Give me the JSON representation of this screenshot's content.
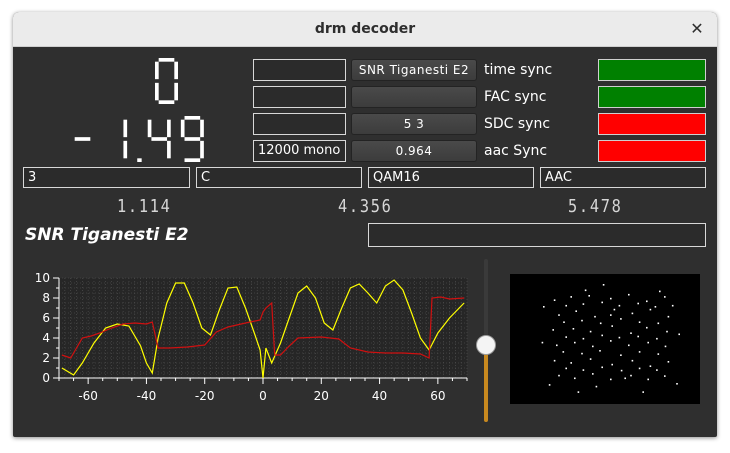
{
  "window": {
    "title": "drm decoder",
    "close_glyph": "✕"
  },
  "display": {
    "big_value_1": "0",
    "big_value_2": "-1.49"
  },
  "fields": {
    "col1": [
      "",
      "",
      "",
      "12000 mono"
    ],
    "col2": [
      "SNR Tiganesti E2",
      "",
      "5 3",
      "0.964"
    ]
  },
  "sync": [
    {
      "label": "time sync",
      "color": "#008000"
    },
    {
      "label": "FAC sync",
      "color": "#008000"
    },
    {
      "label": "SDC sync",
      "color": "#ff0000"
    },
    {
      "label": "aac Sync",
      "color": "#ff0000"
    }
  ],
  "mode_fields": [
    "3",
    "C",
    "QAM16",
    "AAC"
  ],
  "small_readouts": [
    "1.114",
    "4.356",
    "5.478"
  ],
  "station_name": "SNR Tiganesti E2",
  "station_text": "",
  "slider": {
    "value_fraction": 0.47
  },
  "chart_data": {
    "type": "line",
    "title": "",
    "xlabel": "",
    "ylabel": "",
    "xlim": [
      -70,
      70
    ],
    "ylim": [
      0,
      10
    ],
    "xticks": [
      -60,
      -40,
      -20,
      0,
      20,
      40,
      60
    ],
    "yticks": [
      0,
      2,
      4,
      6,
      8,
      10
    ],
    "grid": "dotted",
    "series": [
      {
        "color": "#ffff00",
        "x": [
          -69,
          -65,
          -62,
          -58,
          -54,
          -50,
          -46,
          -42,
          -40,
          -38,
          -36,
          -33,
          -30,
          -27,
          -24,
          -21,
          -18,
          -15,
          -12,
          -9,
          -6,
          -3,
          -1,
          0,
          1,
          3,
          6,
          9,
          12,
          15,
          18,
          21,
          24,
          27,
          30,
          33,
          36,
          39,
          42,
          45,
          48,
          51,
          54,
          57,
          60,
          64,
          69
        ],
        "y": [
          1.0,
          0.3,
          1.5,
          3.5,
          5.0,
          5.4,
          5.2,
          3.2,
          1.5,
          0.5,
          4.0,
          7.5,
          9.5,
          9.5,
          7.5,
          5.0,
          4.3,
          6.8,
          9.0,
          9.1,
          7.0,
          4.5,
          2.8,
          0.0,
          3.0,
          1.5,
          3.5,
          6.0,
          8.5,
          9.2,
          8.0,
          5.5,
          4.8,
          7.0,
          9.0,
          9.4,
          8.5,
          7.5,
          9.2,
          9.8,
          8.8,
          6.5,
          4.0,
          2.8,
          4.5,
          6.0,
          7.5
        ]
      },
      {
        "color": "#d01010",
        "x": [
          -69,
          -66,
          -64,
          -62,
          -59,
          -56,
          -52,
          -48,
          -44,
          -40,
          -38,
          -36,
          -32,
          -26,
          -20,
          -16,
          -12,
          -6,
          -1,
          0,
          1,
          3,
          4,
          6,
          9,
          12,
          20,
          26,
          30,
          36,
          42,
          48,
          54,
          57,
          58,
          61,
          64,
          69
        ],
        "y": [
          2.3,
          2.0,
          3.0,
          4.0,
          4.2,
          4.5,
          5.0,
          5.4,
          5.5,
          5.4,
          5.6,
          3.0,
          3.0,
          3.1,
          3.3,
          4.6,
          5.1,
          5.5,
          5.8,
          6.6,
          7.0,
          7.5,
          2.3,
          2.3,
          3.2,
          4.0,
          4.1,
          3.9,
          3.0,
          2.6,
          2.5,
          2.5,
          2.4,
          2.0,
          8.0,
          8.1,
          7.9,
          8.0
        ]
      }
    ]
  },
  "constellation": {
    "point_color": "#ffffff",
    "points": [
      [
        -0.78,
        0.72
      ],
      [
        -0.55,
        0.78
      ],
      [
        -0.3,
        0.8
      ],
      [
        0.0,
        0.75
      ],
      [
        0.25,
        0.82
      ],
      [
        0.5,
        0.7
      ],
      [
        0.75,
        0.78
      ],
      [
        -0.72,
        0.45
      ],
      [
        -0.48,
        0.52
      ],
      [
        -0.22,
        0.42
      ],
      [
        0.05,
        0.55
      ],
      [
        0.3,
        0.48
      ],
      [
        0.55,
        0.55
      ],
      [
        0.8,
        0.42
      ],
      [
        -0.8,
        0.18
      ],
      [
        -0.52,
        0.2
      ],
      [
        -0.28,
        0.15
      ],
      [
        0.02,
        0.25
      ],
      [
        0.28,
        0.12
      ],
      [
        0.5,
        0.22
      ],
      [
        0.78,
        0.15
      ],
      [
        -0.75,
        -0.1
      ],
      [
        -0.5,
        -0.05
      ],
      [
        -0.25,
        -0.12
      ],
      [
        0.0,
        -0.02
      ],
      [
        0.25,
        -0.1
      ],
      [
        0.52,
        -0.05
      ],
      [
        0.76,
        -0.12
      ],
      [
        -0.78,
        -0.38
      ],
      [
        -0.55,
        -0.42
      ],
      [
        -0.28,
        -0.35
      ],
      [
        0.02,
        -0.45
      ],
      [
        0.3,
        -0.38
      ],
      [
        0.55,
        -0.48
      ],
      [
        0.8,
        -0.4
      ],
      [
        -0.72,
        -0.65
      ],
      [
        -0.5,
        -0.7
      ],
      [
        -0.25,
        -0.62
      ],
      [
        0.0,
        -0.72
      ],
      [
        0.28,
        -0.65
      ],
      [
        0.52,
        -0.72
      ],
      [
        0.75,
        -0.66
      ],
      [
        -0.62,
        0.62
      ],
      [
        -0.38,
        0.65
      ],
      [
        -0.12,
        0.68
      ],
      [
        0.12,
        0.62
      ],
      [
        0.38,
        0.66
      ],
      [
        0.62,
        0.6
      ],
      [
        -0.65,
        0.32
      ],
      [
        -0.4,
        0.35
      ],
      [
        -0.14,
        0.3
      ],
      [
        0.14,
        0.38
      ],
      [
        0.4,
        0.32
      ],
      [
        0.66,
        0.3
      ],
      [
        -0.62,
        0.05
      ],
      [
        -0.38,
        0.02
      ],
      [
        -0.12,
        0.08
      ],
      [
        0.12,
        0.04
      ],
      [
        0.38,
        0.06
      ],
      [
        0.64,
        0.02
      ],
      [
        -0.66,
        -0.22
      ],
      [
        -0.4,
        -0.25
      ],
      [
        -0.15,
        -0.2
      ],
      [
        0.14,
        -0.28
      ],
      [
        0.4,
        -0.22
      ],
      [
        0.66,
        -0.26
      ],
      [
        -0.62,
        -0.52
      ],
      [
        -0.38,
        -0.55
      ],
      [
        -0.12,
        -0.5
      ],
      [
        0.15,
        -0.56
      ],
      [
        0.4,
        -0.52
      ],
      [
        0.64,
        -0.55
      ],
      [
        -0.95,
        -0.05
      ],
      [
        0.95,
        0.1
      ],
      [
        -0.1,
        1.0
      ],
      [
        0.45,
        -0.95
      ],
      [
        -0.45,
        -0.95
      ],
      [
        0.92,
        -0.8
      ],
      [
        -0.93,
        0.6
      ],
      [
        0.0,
        0.45
      ],
      [
        0.2,
        -0.7
      ],
      [
        -0.35,
        0.9
      ],
      [
        0.68,
        0.88
      ],
      [
        -0.85,
        -0.82
      ],
      [
        0.86,
        0.62
      ],
      [
        -0.2,
        -0.85
      ]
    ]
  }
}
